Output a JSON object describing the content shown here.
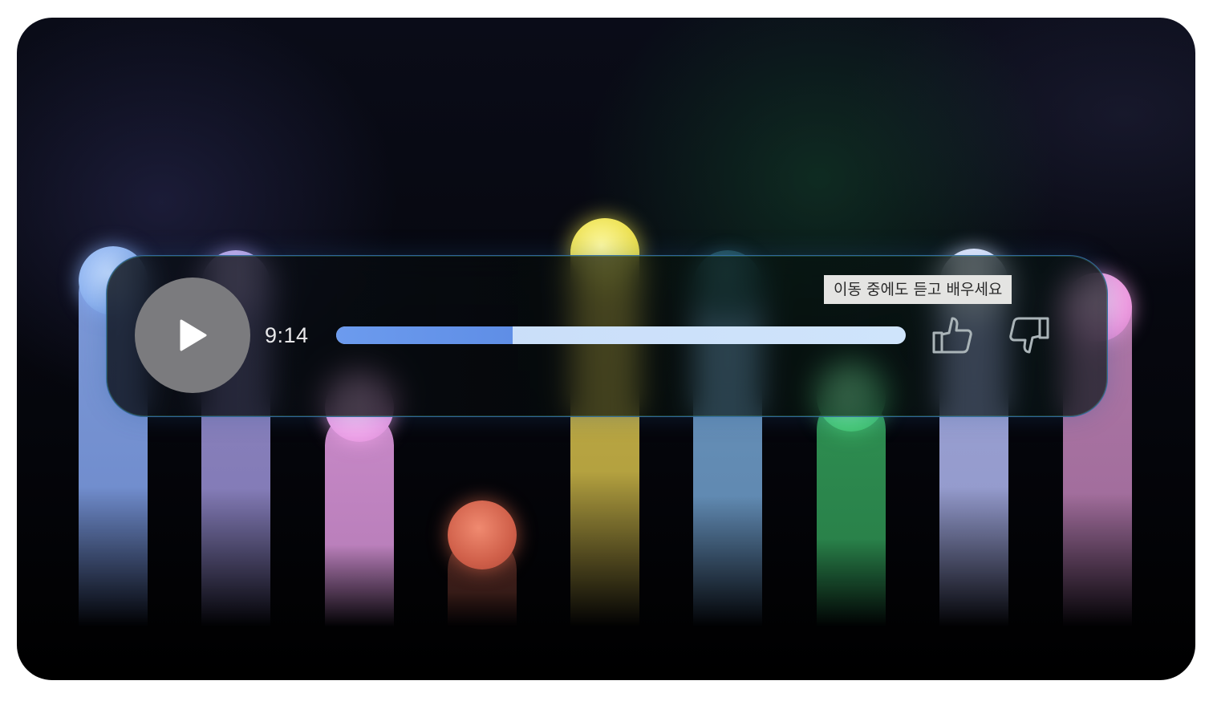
{
  "player": {
    "elapsed_time": "9:14",
    "progress": 0.31,
    "play_icon": "play-icon",
    "like_icon": "thumbs-up-icon",
    "dislike_icon": "thumbs-down-icon"
  },
  "tooltip": {
    "text": "이동 중에도 듣고 배우세요"
  },
  "colors": {
    "progress_fill": "#5f8ee6",
    "progress_track": "#cfe4fb",
    "play_button": "#7b7b7e"
  }
}
